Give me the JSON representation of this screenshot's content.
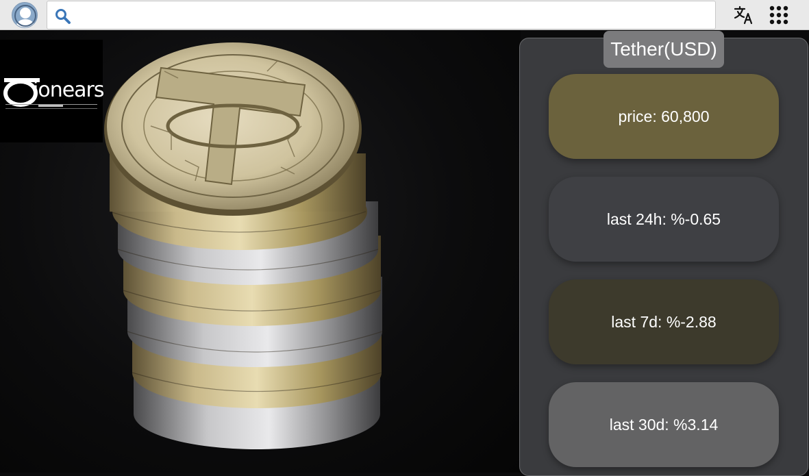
{
  "search": {
    "placeholder": "",
    "value": ""
  },
  "logo": {
    "text": "ionears"
  },
  "panel": {
    "title": "Tether(USD)",
    "price_label": "price: 60,800",
    "change_24h_label": "last 24h: %-0.65",
    "change_7d_label": "last 7d: %-2.88",
    "change_30d_label": "last 30d: %3.14"
  },
  "colors": {
    "price_pill": "#6b623d",
    "change_24h_pill": "#3f4044",
    "change_7d_pill": "#3d3a2c",
    "change_30d_pill": "#636364",
    "panel_bg": "#3a3b3e"
  },
  "icons": {
    "avatar": "avatar-icon",
    "search": "search-icon",
    "translate": "translate-icon",
    "apps": "apps-grid-icon"
  }
}
